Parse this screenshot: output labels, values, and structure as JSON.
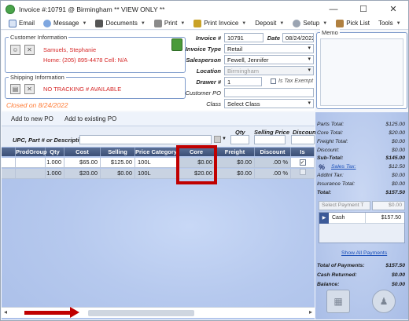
{
  "window": {
    "title": "Invoice #:10791 @ Birmingham ** VIEW ONLY **",
    "min_glyph": "—",
    "max_glyph": "☐",
    "close_glyph": "✕"
  },
  "menu": [
    {
      "label": "Email",
      "icon": "email-icon",
      "dropdown": false
    },
    {
      "label": "Message",
      "icon": "message-icon",
      "dropdown": true
    },
    {
      "label": "Documents",
      "icon": "documents-icon",
      "dropdown": true
    },
    {
      "label": "Print",
      "icon": "printer-icon",
      "dropdown": true
    },
    {
      "label": "Print Invoice",
      "icon": "pen-icon",
      "dropdown": true
    },
    {
      "label": "Deposit",
      "icon": "",
      "dropdown": true
    },
    {
      "label": "Setup",
      "icon": "gear-icon",
      "dropdown": true
    },
    {
      "label": "Pick List",
      "icon": "picklist-icon",
      "dropdown": false
    },
    {
      "label": "Tools",
      "icon": "",
      "dropdown": true
    }
  ],
  "customer": {
    "group_title": "Customer Information",
    "name": "Samuels, Stephanie",
    "phones": "Home: (205) 895-4478 Cell: N/A"
  },
  "shipping": {
    "group_title": "Shipping Information",
    "tracking": "NO TRACKING # AVAILABLE"
  },
  "status_text": "Closed on 8/24/2022",
  "invoice": {
    "invoice_no_label": "Invoice #",
    "invoice_no": "10791",
    "date_label": "Date",
    "date": "08/24/2022",
    "type_label": "Invoice Type",
    "type": "Retail",
    "salesperson_label": "Salesperson",
    "salesperson": "Fewell, Jennifer",
    "location_label": "Location",
    "location": "Birmingham",
    "drawer_label": "Drawer #",
    "drawer": "1",
    "tax_exempt_label": "Is Tax Exempt",
    "customer_po_label": "Customer PO",
    "customer_po": "",
    "class_label": "Class",
    "class_value": "Select Class"
  },
  "memo": {
    "title": "Memo",
    "text": ""
  },
  "tabs": {
    "add_new_po": "Add to new PO",
    "add_existing_po": "Add to existing PO"
  },
  "upc": {
    "label": "UPC, Part # or Description",
    "qty_label": "Qty",
    "price_label": "Selling Price",
    "discount_label": "Discount"
  },
  "grid": {
    "columns": [
      "ProdGroup",
      "Qty",
      "Cost",
      "Selling Price",
      "Price Category",
      "Core",
      "Freight",
      "Discount",
      "Is Taxab"
    ],
    "rows": [
      {
        "prodgroup": "",
        "qty": "1.000",
        "cost": "$65.00",
        "selling_price": "$125.00",
        "price_category": "100L",
        "core": "$0.00",
        "freight": "$0.00",
        "discount": ".00 %",
        "taxable": "✓"
      },
      {
        "prodgroup": "",
        "qty": "1.000",
        "cost": "$20.00",
        "selling_price": "$0.00",
        "price_category": "100L",
        "core": "$20.00",
        "freight": "$0.00",
        "discount": ".00 %",
        "taxable": ""
      }
    ]
  },
  "summary": {
    "parts_total_label": "Parts Total:",
    "parts_total": "$125.00",
    "core_total_label": "Core Total:",
    "core_total": "$20.00",
    "freight_total_label": "Freight Total:",
    "freight_total": "$0.00",
    "discount_label": "Discount:",
    "discount": "$0.00",
    "subtotal_label": "Sub-Total:",
    "subtotal": "$145.00",
    "sales_tax_label": "Sales Tax:",
    "sales_tax": "$12.50",
    "addtl_tax_label": "Addtnl Tax:",
    "addtl_tax": "$0.00",
    "insurance_total_label": "Insurance Total:",
    "insurance_total": "$0.00",
    "total_label": "Total:",
    "total": "$157.50",
    "payment_placeholder": "Select Payment T",
    "payment_amount_placeholder": "$0.00",
    "payments": [
      {
        "method": "Cash",
        "amount": "$157.50"
      }
    ],
    "show_all_payments": "Show All Payments",
    "total_payments_label": "Total of Payments:",
    "total_payments": "$157.50",
    "cash_returned_label": "Cash Returned:",
    "cash_returned": "$0.00",
    "balance_label": "Balance:",
    "balance": "$0.00"
  },
  "colors": {
    "highlight": "#c00000",
    "status_orange": "#ff7a33",
    "customer_red": "#d62828"
  }
}
